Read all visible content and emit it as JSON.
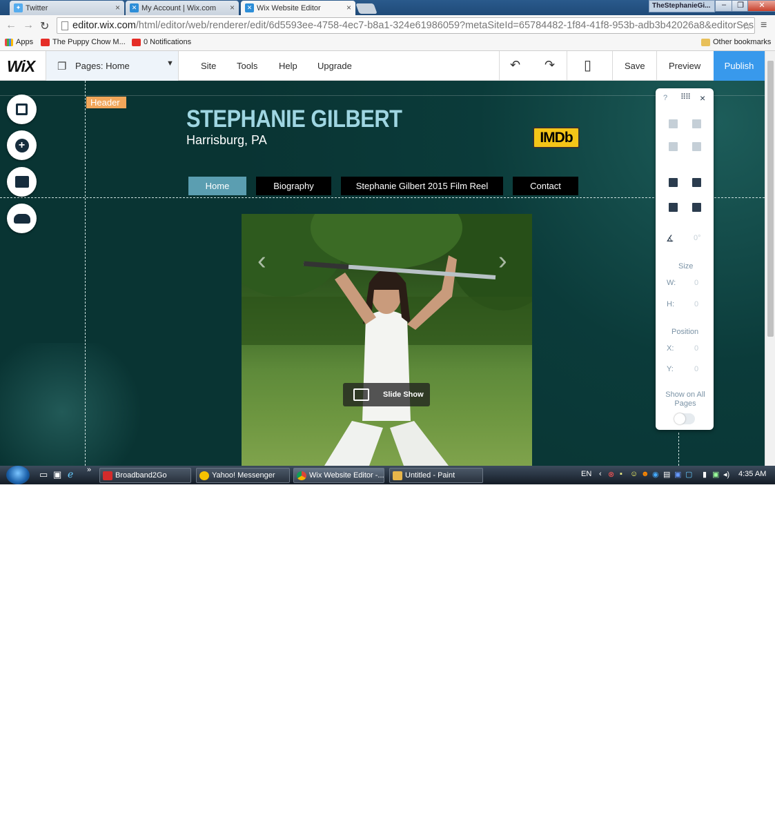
{
  "browser": {
    "tabs": [
      {
        "title": "Twitter",
        "active": false
      },
      {
        "title": "My Account | Wix.com",
        "active": false
      },
      {
        "title": "Wix Website Editor",
        "active": true
      }
    ],
    "window_title": "TheStephanieGi...",
    "url_host": "editor.wix.com",
    "url_rest": "/html/editor/web/renderer/edit/6d5593ee-4758-4ec7-b8a1-324e61986059?metaSiteId=65784482-1f84-41f8-953b-adb3b42026a8&editorSes",
    "bookmarks": [
      "Apps",
      "The Puppy Chow M...",
      "0 Notifications"
    ],
    "other_bookmarks": "Other bookmarks"
  },
  "wix_topbar": {
    "logo": "WiX",
    "pages_label": "Pages: Home",
    "menu": [
      "Site",
      "Tools",
      "Help",
      "Upgrade"
    ],
    "save": "Save",
    "preview": "Preview",
    "publish": "Publish"
  },
  "site": {
    "header_tag": "Header",
    "title": "STEPHANIE GILBERT",
    "subtitle": "Harrisburg, PA",
    "imdb": "IMDb",
    "nav": [
      "Home",
      "Biography",
      "Stephanie Gilbert 2015 Film Reel",
      "Contact"
    ],
    "slideshow_label": "Slide Show"
  },
  "panel": {
    "help": "?",
    "close": "×",
    "angle": "0°",
    "size_title": "Size",
    "w_label": "W:",
    "w_value": "0",
    "h_label": "H:",
    "h_value": "0",
    "position_title": "Position",
    "x_label": "X:",
    "x_value": "0",
    "y_label": "Y:",
    "y_value": "0",
    "show_on_all": "Show on All Pages"
  },
  "taskbar": {
    "items": [
      "Broadband2Go",
      "Yahoo! Messenger",
      "Wix Website Editor -...",
      "Untitled - Paint"
    ],
    "lang": "EN",
    "time": "4:35 AM"
  },
  "colors": {
    "publish": "#3899ec",
    "canvas_bg": "#093433",
    "site_title": "#9fd6e2",
    "nav_active": "#5b9eb1",
    "header_tag": "#f2a65a",
    "imdb": "#f5c518"
  }
}
